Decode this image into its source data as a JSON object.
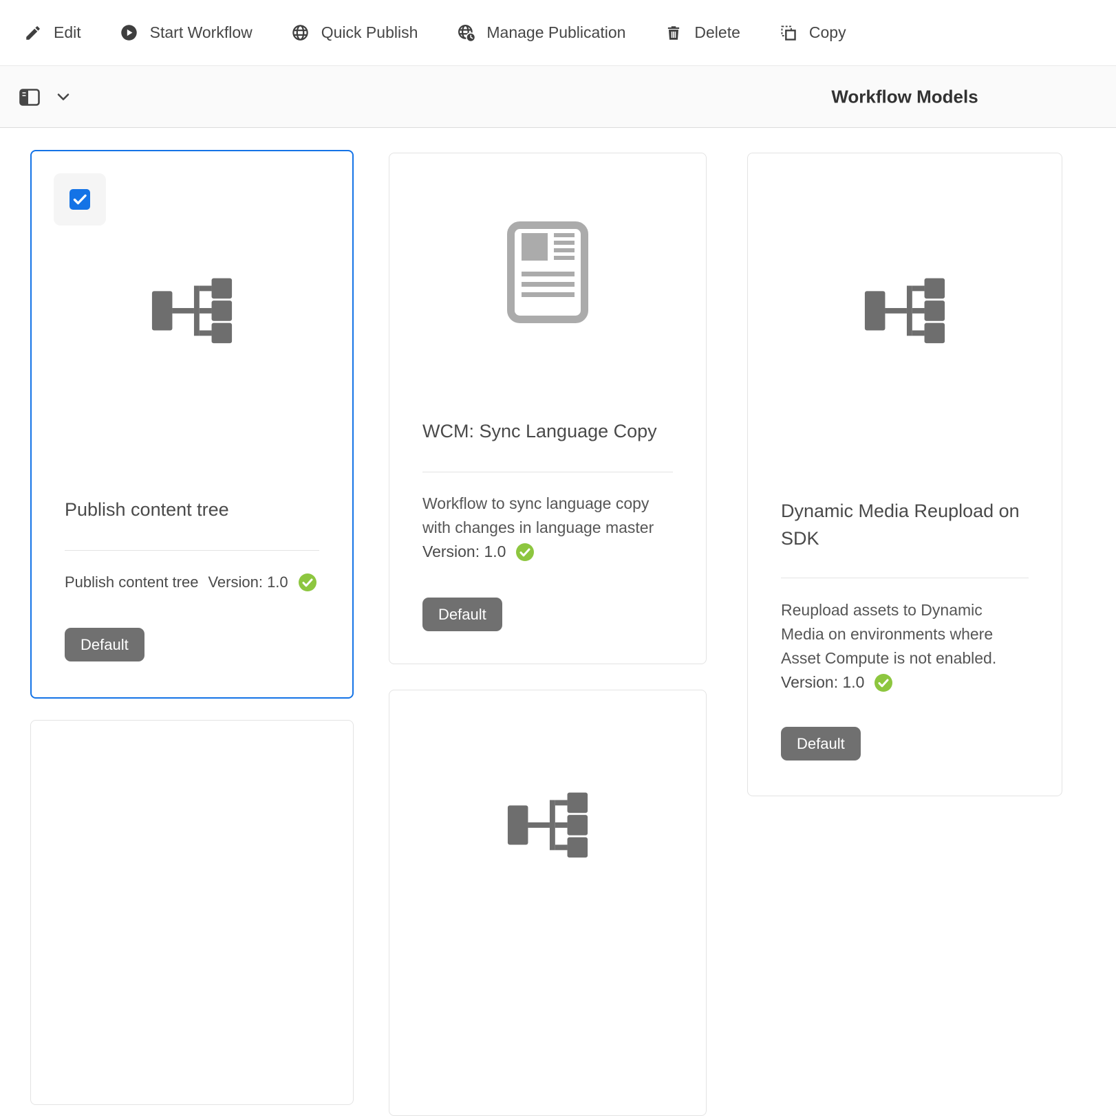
{
  "toolbar": {
    "items": [
      {
        "label": "Edit",
        "icon": "edit-icon"
      },
      {
        "label": "Start Workflow",
        "icon": "play-circle-icon"
      },
      {
        "label": "Quick Publish",
        "icon": "globe-icon"
      },
      {
        "label": "Manage Publication",
        "icon": "globe-clock-icon"
      },
      {
        "label": "Delete",
        "icon": "trash-icon"
      },
      {
        "label": "Copy",
        "icon": "copy-icon"
      }
    ]
  },
  "header": {
    "title": "Workflow Models",
    "rail_toggle_icon": "content-rail-icon",
    "chevron_icon": "chevron-down-icon"
  },
  "cards": [
    {
      "title": "Publish content tree",
      "meta_title": "Publish content tree",
      "version_label": "Version: 1.0",
      "badge": "Default",
      "icon": "workflow-tree-icon",
      "status_icon": "check-circle-icon",
      "selected": true
    },
    {
      "title": "WCM: Sync Language Copy",
      "description": "Workflow to sync language copy with changes in language master",
      "version_label": "Version: 1.0",
      "badge": "Default",
      "icon": "article-icon",
      "status_icon": "check-circle-icon"
    },
    {
      "title": "Dynamic Media Reupload on SDK",
      "description": "Reupload assets to Dynamic Media on environments where Asset Compute is not enabled.",
      "version_label": "Version: 1.0",
      "badge": "Default",
      "icon": "workflow-tree-icon",
      "status_icon": "check-circle-icon"
    },
    {},
    {
      "icon": "workflow-tree-icon"
    }
  ],
  "colors": {
    "accent_blue": "#1473e6",
    "success_green": "#8dc63f",
    "badge_gray": "#707070"
  }
}
